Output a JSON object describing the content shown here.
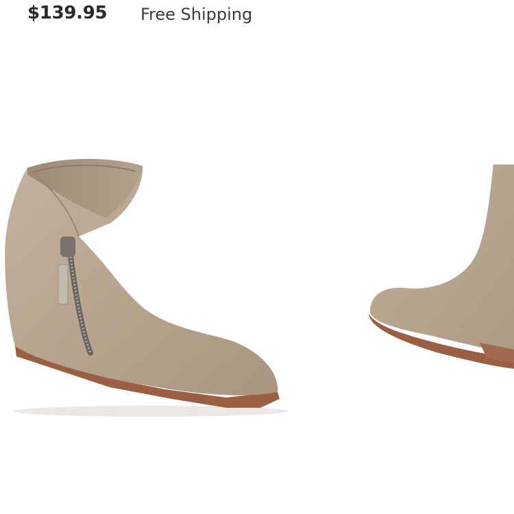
{
  "product": {
    "price": "$139.95",
    "shipping": "Free Shipping"
  },
  "gallery": {
    "main_image": "ankle-bootie-wedge-side-view",
    "next_image": "ankle-bootie-wedge-front-view"
  },
  "colors": {
    "suede": "#b6a48f",
    "wedge": "#a9735b",
    "sole": "#9b5f44"
  }
}
